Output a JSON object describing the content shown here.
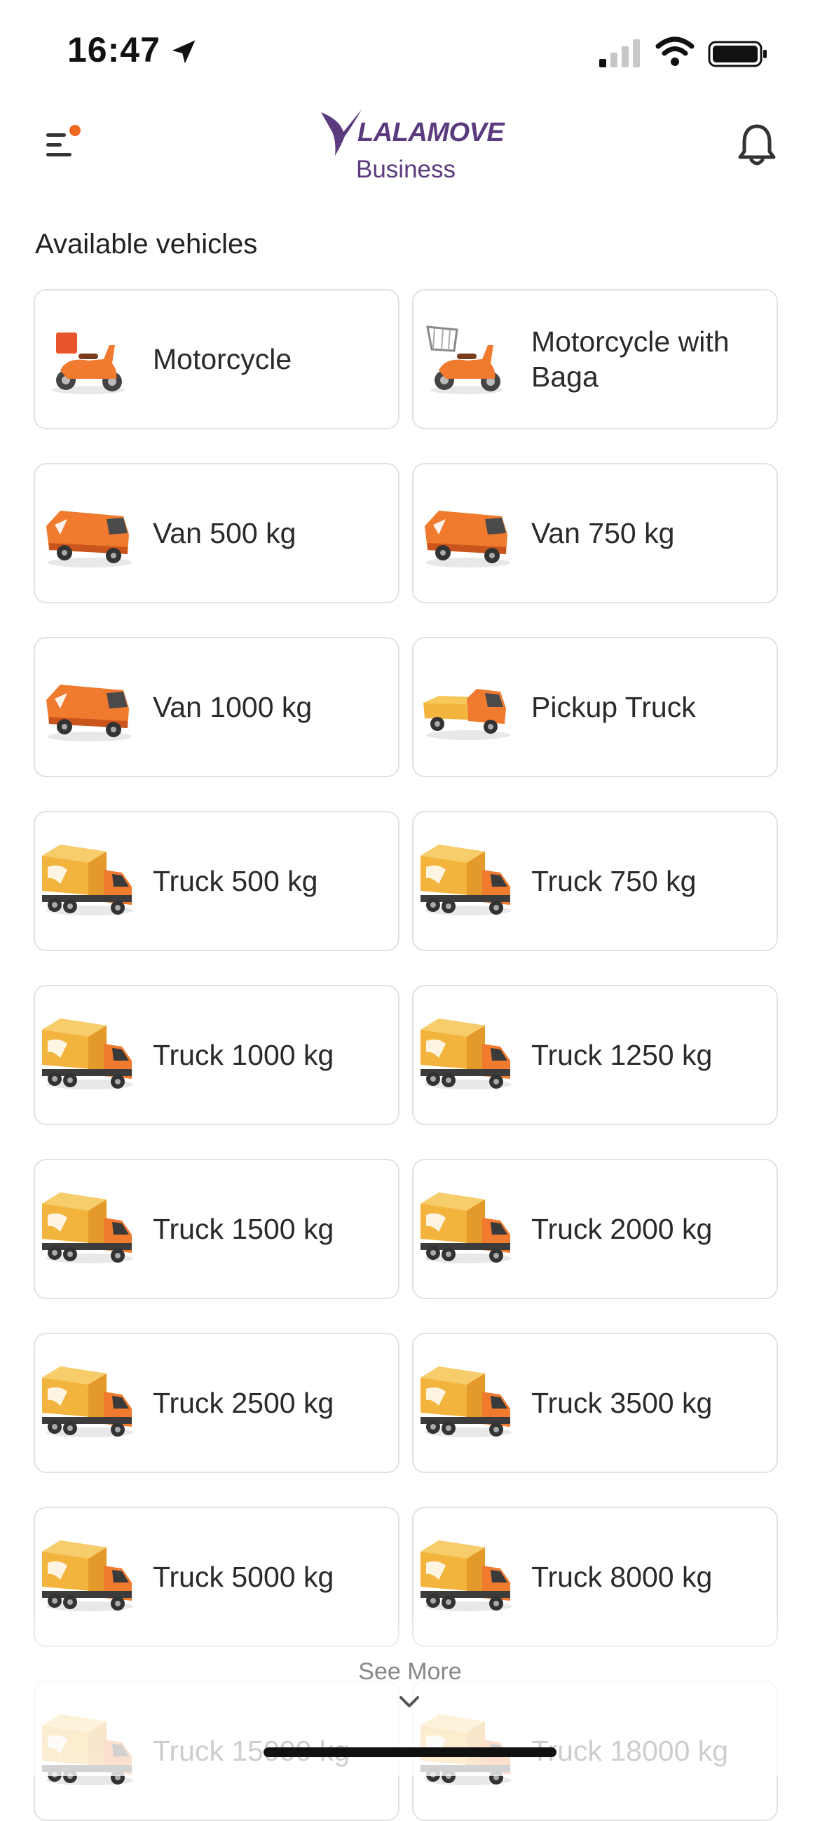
{
  "status_bar": {
    "time": "16:47"
  },
  "header": {
    "logo_text": "LALAMOVE",
    "logo_subtitle": "Business",
    "accent_color": "#5b3a7d",
    "notification_dot_color": "#f26a21"
  },
  "section_title": "Available vehicles",
  "vehicles": [
    {
      "label": "Motorcycle",
      "icon": "motorcycle-icon"
    },
    {
      "label": "Motorcycle with Baga",
      "icon": "motorcycle-basket-icon"
    },
    {
      "label": "Van 500 kg",
      "icon": "van-icon"
    },
    {
      "label": "Van 750 kg",
      "icon": "van-icon"
    },
    {
      "label": "Van 1000 kg",
      "icon": "van-icon"
    },
    {
      "label": "Pickup Truck",
      "icon": "pickup-truck-icon"
    },
    {
      "label": "Truck 500 kg",
      "icon": "truck-icon"
    },
    {
      "label": "Truck 750 kg",
      "icon": "truck-icon"
    },
    {
      "label": "Truck 1000 kg",
      "icon": "truck-icon"
    },
    {
      "label": "Truck 1250 kg",
      "icon": "truck-icon"
    },
    {
      "label": "Truck 1500 kg",
      "icon": "truck-icon"
    },
    {
      "label": "Truck 2000 kg",
      "icon": "truck-icon"
    },
    {
      "label": "Truck 2500 kg",
      "icon": "truck-icon"
    },
    {
      "label": "Truck 3500 kg",
      "icon": "truck-icon"
    },
    {
      "label": "Truck 5000 kg",
      "icon": "truck-icon"
    },
    {
      "label": "Truck 8000 kg",
      "icon": "truck-icon"
    },
    {
      "label": "Truck 15000 kg",
      "icon": "truck-icon"
    },
    {
      "label": "Truck 18000 kg",
      "icon": "truck-icon"
    }
  ],
  "see_more_label": "See More"
}
